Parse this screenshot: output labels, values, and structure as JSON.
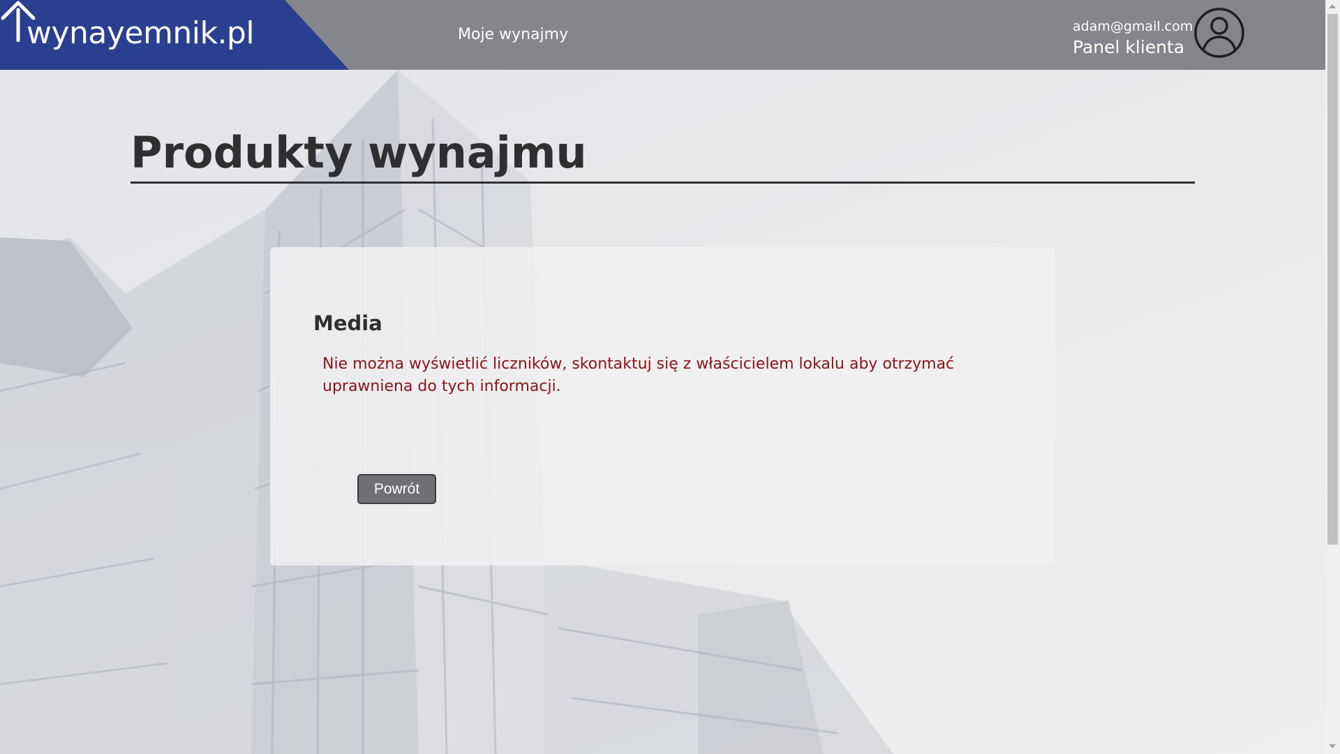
{
  "header": {
    "logo_text": "wynayemnik.pl",
    "nav_link": "Moje wynajmy",
    "user_email": "adam@gmail.com",
    "user_panel_label": "Panel klienta"
  },
  "main": {
    "page_title": "Produkty wynajmu",
    "card": {
      "title": "Media",
      "error_message": "Nie można wyświetlić liczników, skontaktuj się z właścicielem lokalu aby otrzymać uprawniena do tych informacji.",
      "back_button_label": "Powrót"
    }
  },
  "colors": {
    "header_bg": "#85868b",
    "logo_bg": "#2b3f91",
    "error_text": "#8c1313",
    "button_bg": "#6f7074"
  },
  "icons": {
    "logo_house": "house-roof-icon",
    "avatar": "user-circle-icon"
  }
}
